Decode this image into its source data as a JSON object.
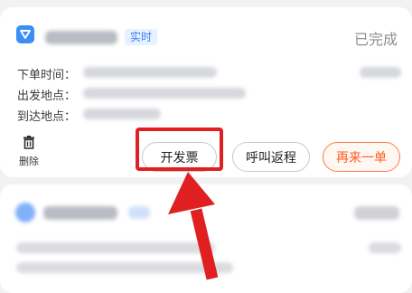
{
  "order_card": {
    "tag": "实时",
    "status": "已完成",
    "fields": {
      "order_time_label": "下单时间：",
      "departure_label": "出发地点：",
      "destination_label": "到达地点："
    },
    "delete_label": "删除",
    "buttons": {
      "invoice": "开发票",
      "call_back": "呼叫返程",
      "order_again": "再来一单"
    }
  },
  "colors": {
    "accent_blue": "#3a8ef6",
    "highlight_red": "#e02020",
    "order_again_orange": "#ff5b1f"
  },
  "icons": {
    "brand": "ride-app-logo-icon",
    "delete": "trash-icon",
    "annotation": "red-arrow-icon"
  }
}
